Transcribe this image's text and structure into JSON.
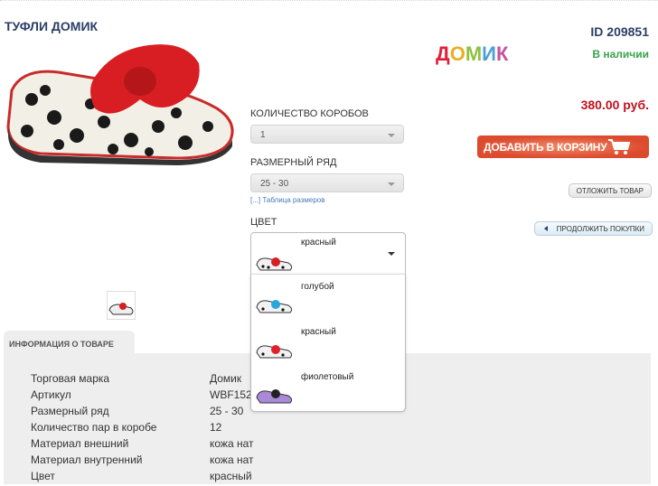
{
  "product": {
    "title": "ТУФЛИ ДОМИК",
    "id": "ID 209851",
    "brand_logo": "ДОМИК",
    "availability": "В наличии",
    "price": "380.00 руб."
  },
  "form": {
    "boxes_label": "КОЛИЧЕСТВО КОРОБОВ",
    "boxes_value": "1",
    "size_label": "РАЗМЕРНЫЙ РЯД",
    "size_value": "25 - 30",
    "size_table_link": "[...] Таблица размеров",
    "color_label": "ЦВЕТ",
    "color_value": "красный",
    "color_options": [
      {
        "label": "голубой",
        "color": "#2aa7d8"
      },
      {
        "label": "красный",
        "color": "#e0202a"
      },
      {
        "label": "фиолетовый",
        "color": "#222222"
      }
    ]
  },
  "actions": {
    "add_to_cart": "ДОБАВИТЬ В КОРЗИНУ",
    "save": "ОТЛОЖИТЬ ТОВАР",
    "continue": "ПРОДОЛЖИТЬ ПОКУПКИ"
  },
  "info": {
    "tab": "ИНФОРМАЦИЯ О ТОВАРЕ",
    "rows": [
      {
        "k": "Торговая марка",
        "v": "Домик"
      },
      {
        "k": "Артикул",
        "v": "WBF152"
      },
      {
        "k": "Размерный ряд",
        "v": "25 - 30"
      },
      {
        "k": "Количество пар в коробе",
        "v": "12"
      },
      {
        "k": "Материал внешний",
        "v": "кожа нат"
      },
      {
        "k": "Материал внутренний",
        "v": "кожа нат"
      },
      {
        "k": "Цвет",
        "v": "красный"
      }
    ]
  },
  "colors": {
    "accent_red": "#dd4b2e",
    "price": "#c0111f",
    "title": "#2c3e66",
    "available": "#3aa34a"
  }
}
